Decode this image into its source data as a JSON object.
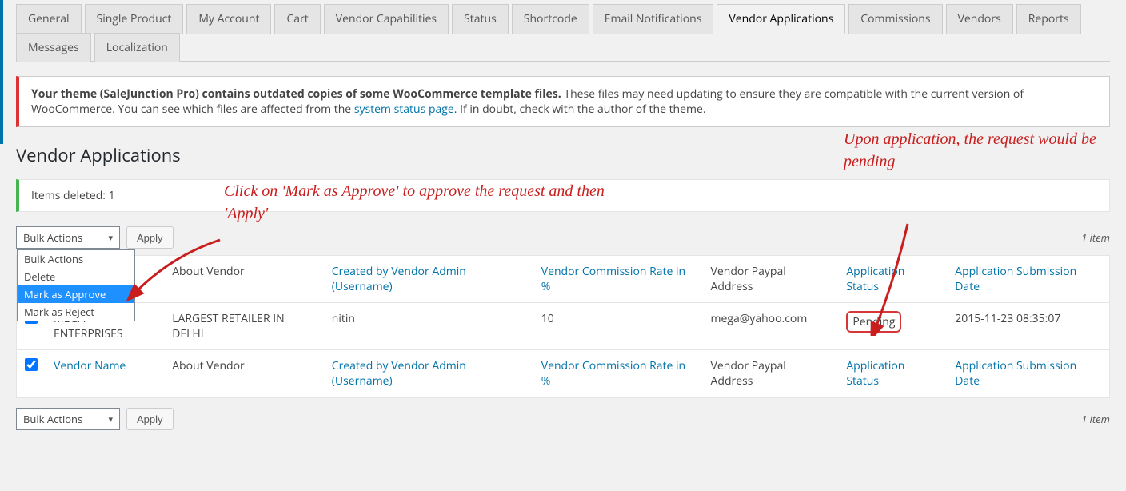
{
  "tabs_row1": [
    "General",
    "Single Product",
    "My Account",
    "Cart",
    "Vendor Capabilities",
    "Status",
    "Shortcode",
    "Email Notifications",
    "Vendor Applications",
    "Commissions"
  ],
  "tabs_row2": [
    "Vendors",
    "Reports",
    "Messages",
    "Localization"
  ],
  "active_tab": "Vendor Applications",
  "notice": {
    "bold": "Your theme (SaleJunction Pro) contains outdated copies of some WooCommerce template files.",
    "text1": " These files may need updating to ensure they are compatible with the current version of WooCommerce. You can see which files are affected from the ",
    "link": "system status page",
    "text2": ". If in doubt, check with the author of the theme."
  },
  "section_title": "Vendor Applications",
  "deleted_msg": "Items deleted: 1",
  "bulk": {
    "selected": "Bulk Actions",
    "options": [
      "Bulk Actions",
      "Delete",
      "Mark as Approve",
      "Mark as Reject"
    ],
    "apply": "Apply"
  },
  "item_count": "1 item",
  "columns": {
    "vendor_name": "Vendor Name",
    "about": "About Vendor",
    "created_by": "Created by Vendor Admin (Username)",
    "commission": "Vendor Commission Rate in %",
    "paypal": "Vendor Paypal Address",
    "status": "Application Status",
    "date": "Application Submission Date"
  },
  "rows": [
    {
      "name": "MEGA ENTERPRISES",
      "about": "LARGEST RETAILER IN DELHI",
      "created": "nitin",
      "rate": "10",
      "paypal": "mega@yahoo.com",
      "status": "Pending",
      "date": "2015-11-23 08:35:07"
    }
  ],
  "annotations": {
    "left": "Click on 'Mark as Approve' to approve the request and then 'Apply'",
    "right": "Upon application, the request would be pending"
  }
}
